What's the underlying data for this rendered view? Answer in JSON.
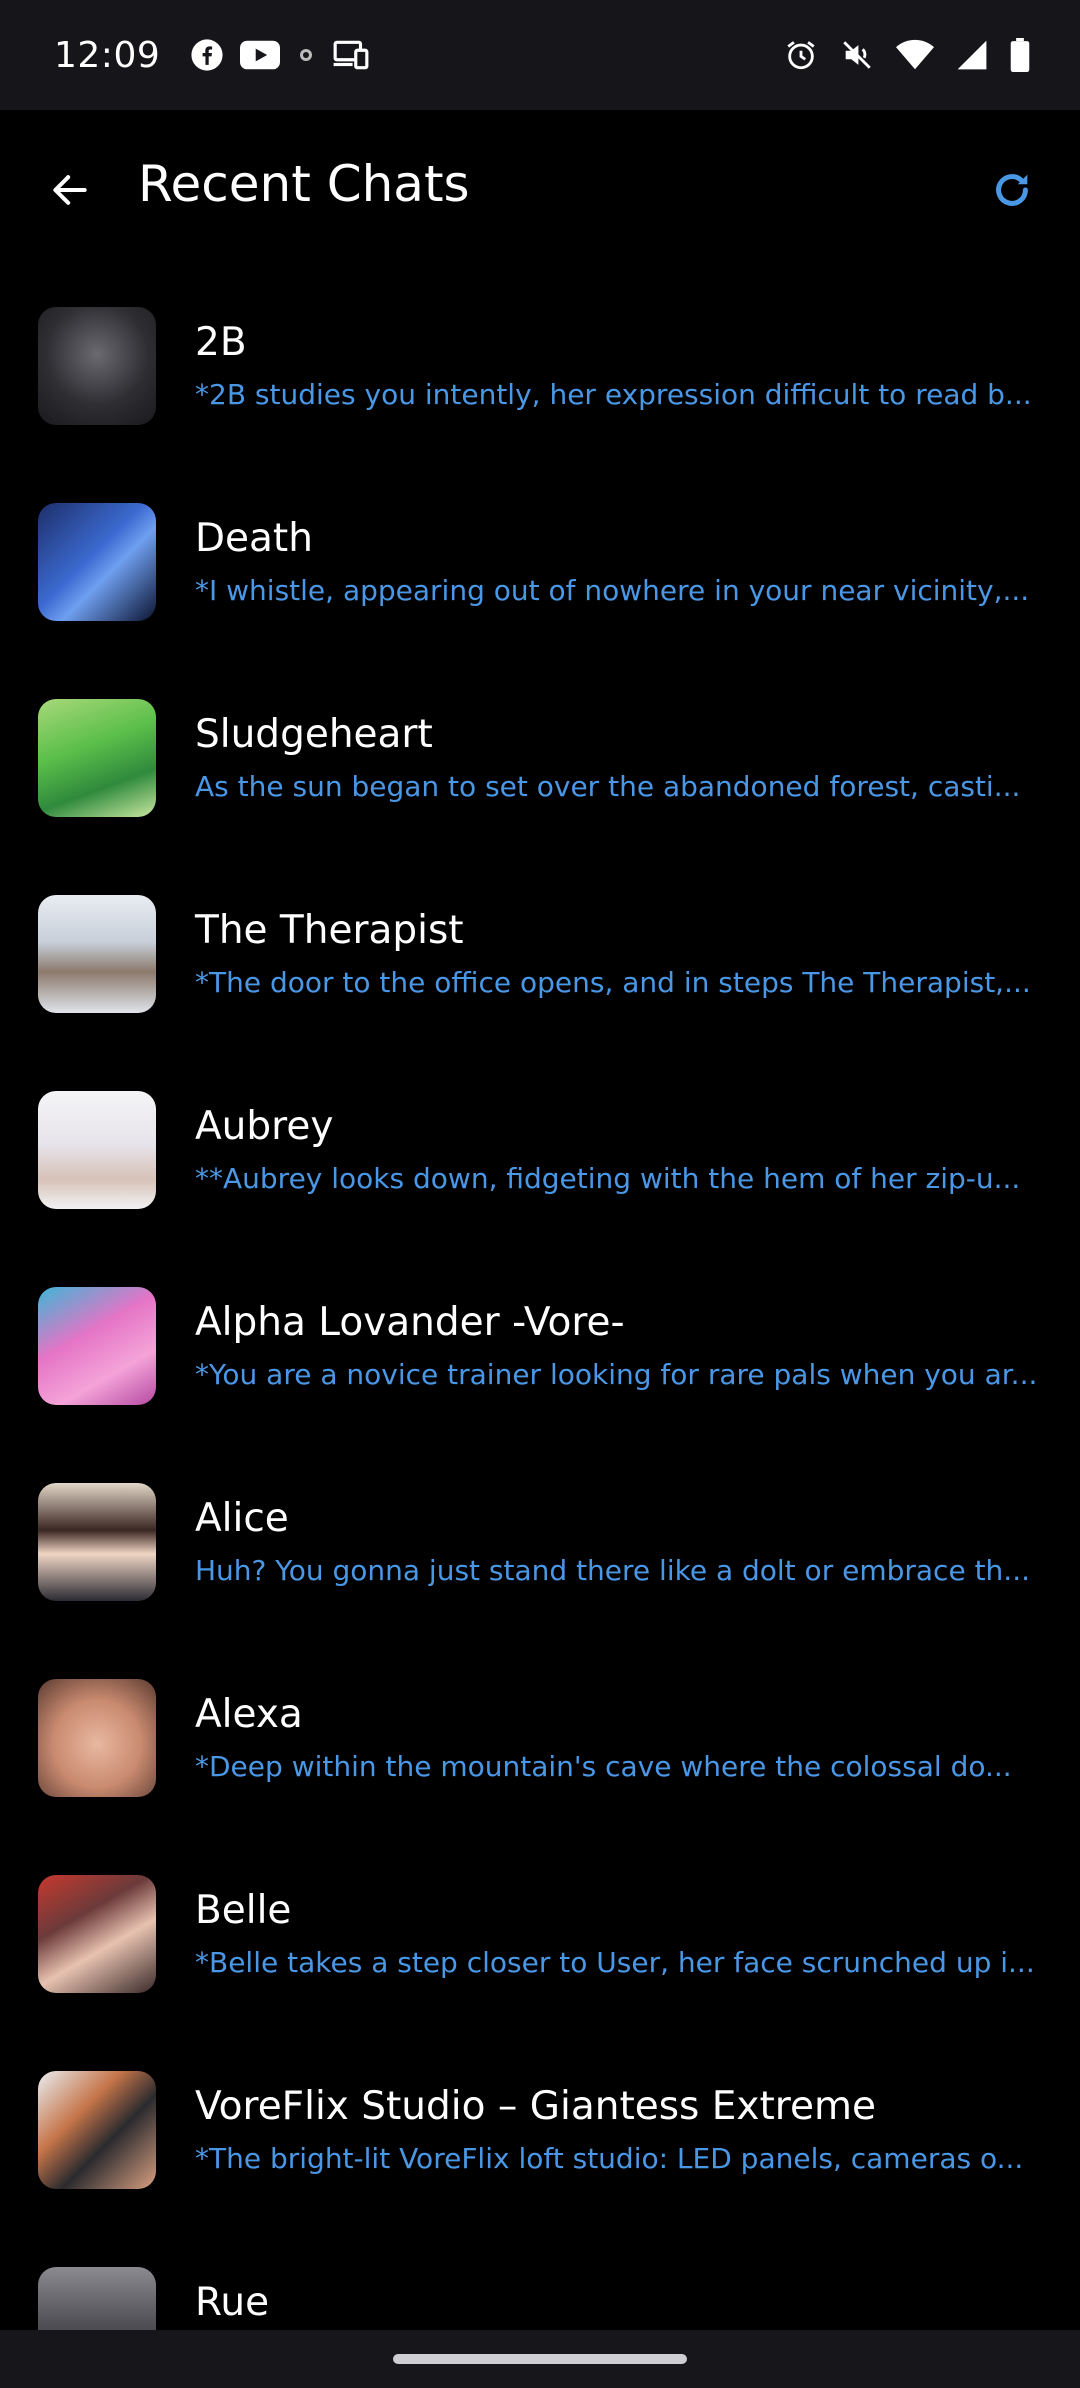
{
  "status_bar": {
    "time": "12:09",
    "left_icons": [
      "facebook-icon",
      "youtube-icon",
      "small-dot-icon",
      "cast-devices-icon"
    ],
    "right_icons": [
      "alarm-icon",
      "mute-icon",
      "wifi-icon",
      "signal-icon",
      "battery-icon"
    ]
  },
  "app_bar": {
    "title": "Recent Chats",
    "back_icon": "arrow-back-icon",
    "refresh_icon": "refresh-icon",
    "accent_color": "#4a97e6"
  },
  "chats": [
    {
      "name": "2B",
      "preview": "*2B studies you intently, her expression difficult to read b..."
    },
    {
      "name": "Death",
      "preview": "*I whistle, appearing out of nowhere in your near vicinity,..."
    },
    {
      "name": "Sludgeheart",
      "preview": "As the sun began to set over the abandoned forest, casti..."
    },
    {
      "name": "The Therapist",
      "preview": "*The door to the office opens, and in steps The Therapist,..."
    },
    {
      "name": "Aubrey",
      "preview": "**Aubrey looks down, fidgeting with the hem of her zip-u..."
    },
    {
      "name": "Alpha Lovander -Vore-",
      "preview": "*You are a novice trainer looking for rare pals when you ar..."
    },
    {
      "name": "Alice",
      "preview": "Huh? You gonna just stand there like a dolt or embrace th..."
    },
    {
      "name": "Alexa",
      "preview": "*Deep within the mountain's cave where the colossal do..."
    },
    {
      "name": "Belle",
      "preview": "*Belle takes a step closer to User, her face scrunched up i..."
    },
    {
      "name": "VoreFlix Studio – Giantess Extreme",
      "preview": "*The bright-lit VoreFlix loft studio: LED panels, cameras o..."
    },
    {
      "name": "Rue",
      "preview": ""
    }
  ]
}
